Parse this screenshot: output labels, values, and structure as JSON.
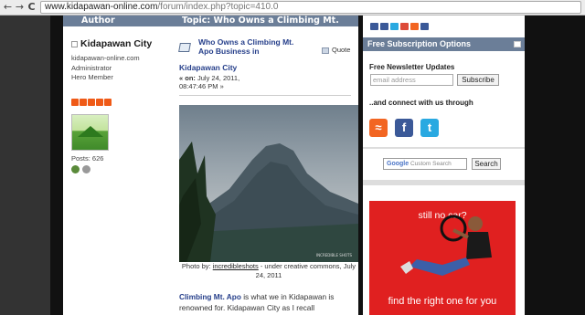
{
  "browser": {
    "back_glyph": "←",
    "forward_glyph": "→",
    "reload_glyph": "C",
    "url_domain": "www.kidapawan-online.com",
    "url_path": "/forum/index.php?topic=410.0"
  },
  "forum": {
    "header": {
      "author_label": "Author",
      "topic_label": "Topic: Who Owns a Climbing Mt. Apo"
    },
    "poster": {
      "name": "Kidapawan City",
      "site": "kidapawan-online.com",
      "role": "Administrator",
      "rank": "Hero Member",
      "rank_stars": 5,
      "posts": "Posts: 626"
    },
    "post": {
      "title": "Who Owns a Climbing Mt. Apo Business in",
      "title_city": "Kidapawan City",
      "quote_label": "Quote",
      "date_prefix": "« on:",
      "date": "July 24, 2011,",
      "time": "08:47:46 PM »",
      "photo_watermark": "INCREDIBLE SHOTS",
      "caption_prefix": "Photo by:",
      "caption_link": "incredibleshots",
      "caption_suffix": "- under creative commons, July 24, 2011",
      "body_bold": "Climbing Mt. Apo",
      "body_text": " is what we in Kidapawan is renowned for. Kidapawan City as I recall"
    }
  },
  "sidebar": {
    "subscription_title": "Free Subscription Options",
    "newsletter_label": "Free Newsletter Updates",
    "email_placeholder": "email address",
    "subscribe_label": "Subscribe",
    "connect_label": "..and connect with us through",
    "social": [
      {
        "name": "rss",
        "glyph": "≈",
        "color": "#f26522"
      },
      {
        "name": "facebook",
        "glyph": "f",
        "color": "#3b5998"
      },
      {
        "name": "twitter",
        "glyph": "t",
        "color": "#29a9e1"
      }
    ],
    "google_label": "Google",
    "search_placeholder": "Custom Search",
    "search_label": "Search"
  },
  "ad": {
    "headline": "still no car?",
    "tagline": "find the right one for you",
    "colors": {
      "background": "#e02020",
      "text": "#ffffff"
    }
  },
  "colors": {
    "header": "#6b7e98",
    "link": "#27408b",
    "rank_star": "#ef5a17"
  }
}
